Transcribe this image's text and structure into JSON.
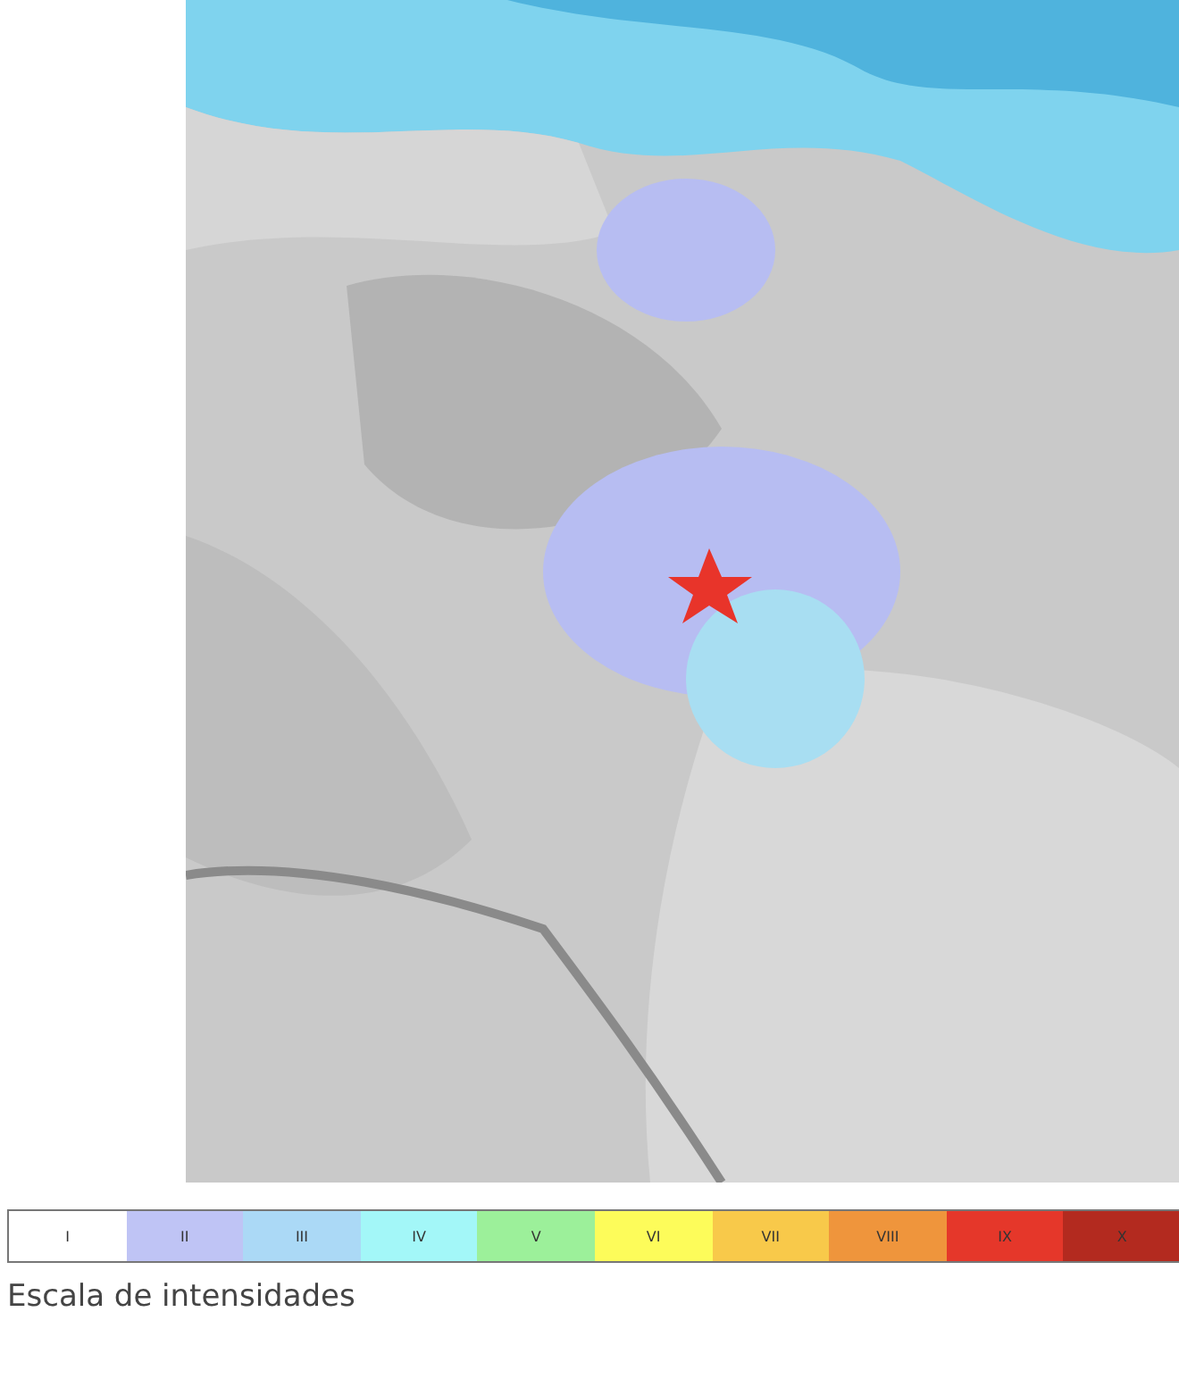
{
  "scale": {
    "levels": [
      {
        "label": "I",
        "color": "#ffffff"
      },
      {
        "label": "II",
        "color": "#bfc4f5"
      },
      {
        "label": "III",
        "color": "#abd9f6"
      },
      {
        "label": "IV",
        "color": "#a3f7f8"
      },
      {
        "label": "V",
        "color": "#9cf09a"
      },
      {
        "label": "VI",
        "color": "#fdfc5a"
      },
      {
        "label": "VII",
        "color": "#f8c94a"
      },
      {
        "label": "VIII",
        "color": "#ef953c"
      },
      {
        "label": "IX",
        "color": "#e5372a"
      },
      {
        "label": "X",
        "color": "#b32a1f"
      }
    ],
    "caption": "Escala de intensidades"
  }
}
